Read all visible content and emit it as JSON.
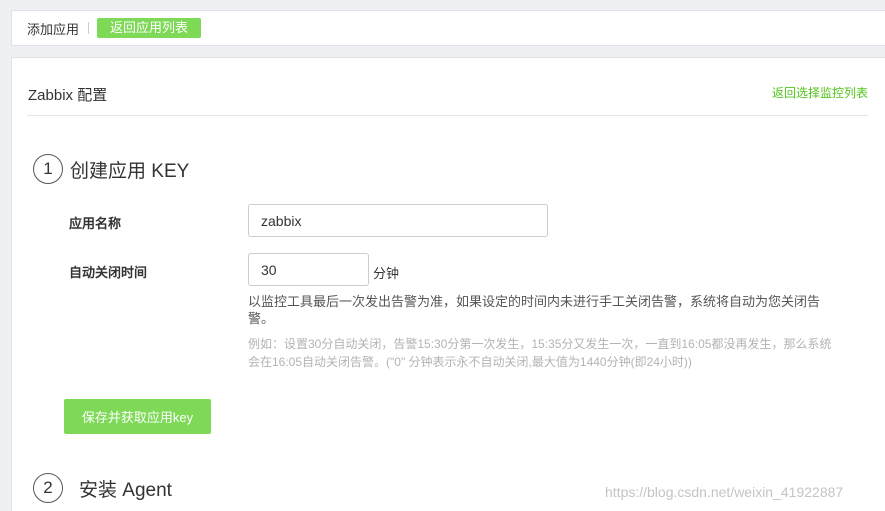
{
  "topbar": {
    "title": "添加应用",
    "back_button": "返回应用列表"
  },
  "panel": {
    "title": "Zabbix 配置",
    "back_link": "返回选择监控列表"
  },
  "step1": {
    "number": "1",
    "label": "创建应用 KEY"
  },
  "form": {
    "app_name": {
      "label": "应用名称",
      "value": "zabbix"
    },
    "auto_close": {
      "label": "自动关闭时间",
      "value": "30",
      "unit": "分钟",
      "help": "以监控工具最后一次发出告警为准，如果设定的时间内未进行手工关闭告警，系统将自动为您关闭告警。",
      "example": "例如：设置30分自动关闭，告警15:30分第一次发生，15:35分又发生一次，一直到16:05都没再发生，那么系统会在16:05自动关闭告警。(\"0\" 分钟表示永不自动关闭,最大值为1440分钟(即24小时))"
    },
    "submit_button": "保存并获取应用key"
  },
  "step2": {
    "number": "2",
    "label": "安装 Agent"
  },
  "watermark": "https://blog.csdn.net/weixin_41922887",
  "colors": {
    "accent": "#7ed957",
    "link": "#52c41a"
  }
}
